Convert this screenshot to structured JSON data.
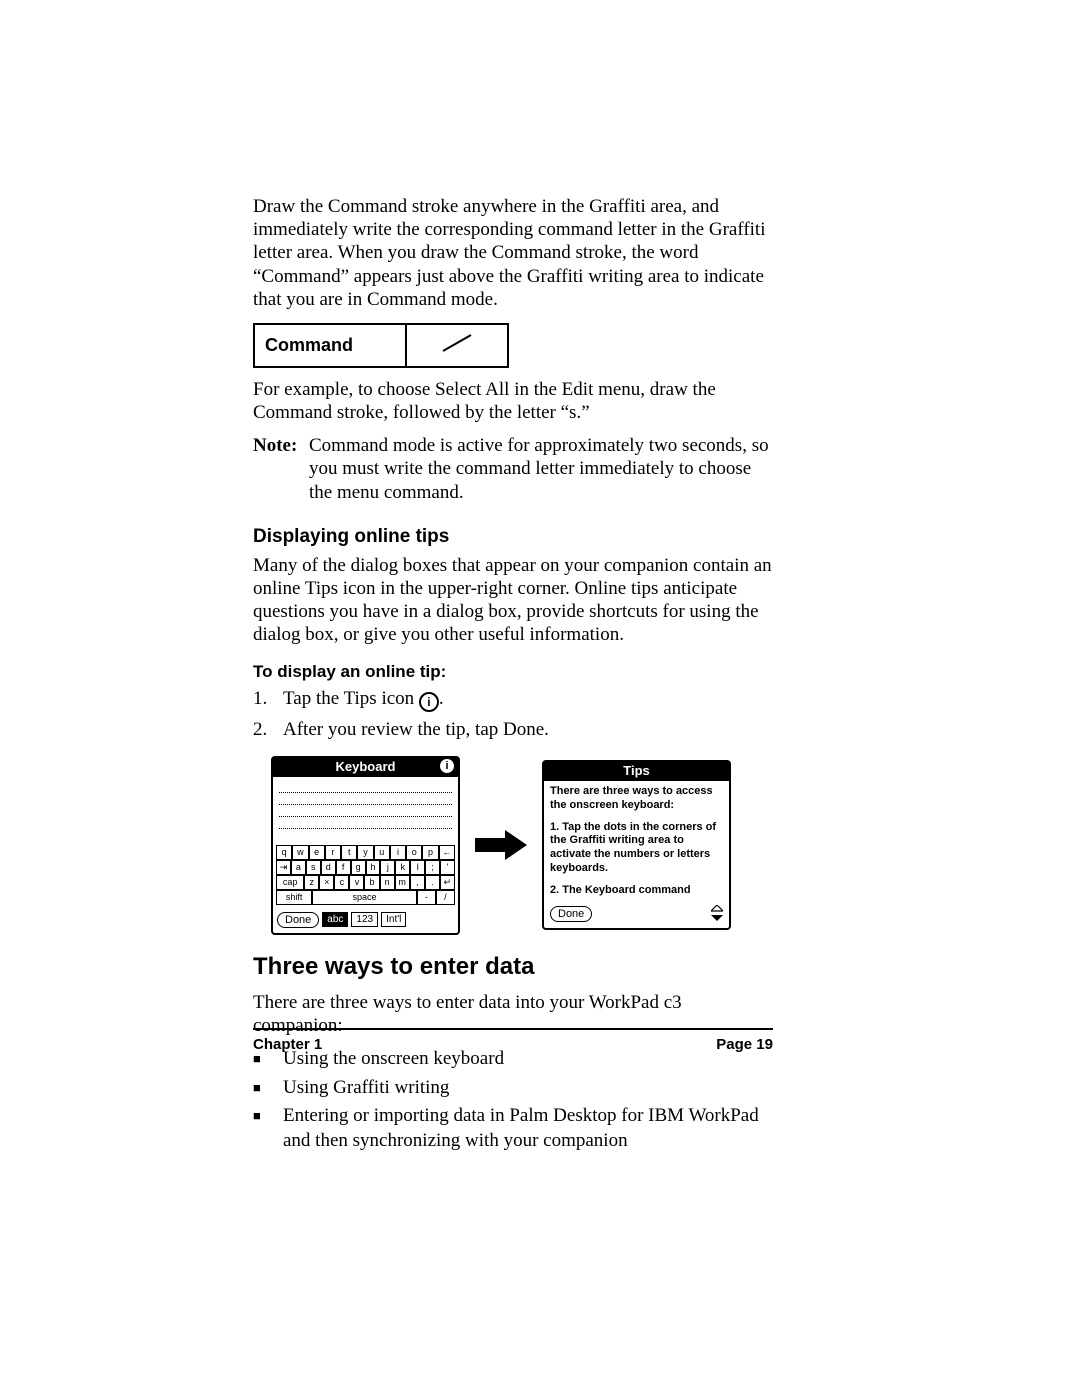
{
  "intro_paragraph": "Draw the Command stroke anywhere in the Graffiti area, and immediately write the corresponding command letter in the Graffiti letter area. When you draw the Command stroke, the word “Command” appears just above the Graffiti writing area to indicate that you are in Command mode.",
  "command_figure": {
    "label": "Command"
  },
  "example_paragraph": "For example, to choose Select All in the Edit menu, draw the Command stroke, followed by the letter “s.”",
  "note": {
    "label": "Note:",
    "text": "Command mode is active for approximately two seconds, so you must write the command letter immediately to choose the menu command."
  },
  "section_tips": {
    "heading": "Displaying online tips",
    "paragraph": "Many of the dialog boxes that appear on your companion contain an online Tips icon in the upper-right corner. Online tips anticipate questions you have in a dialog box, provide shortcuts for using the dialog box, or give you other useful information.",
    "subheading": "To display an online tip:",
    "steps": [
      {
        "num": "1.",
        "text_before": "Tap the Tips icon ",
        "icon": "i",
        "text_after": "."
      },
      {
        "num": "2.",
        "text": "After you review the tip, tap Done."
      }
    ]
  },
  "keyboard_screen": {
    "title": "Keyboard",
    "info_icon": "i",
    "rows": {
      "r1": [
        "q",
        "w",
        "e",
        "r",
        "t",
        "y",
        "u",
        "i",
        "o",
        "p",
        "←"
      ],
      "r2": [
        "⇥",
        "a",
        "s",
        "d",
        "f",
        "g",
        "h",
        "j",
        "k",
        "l",
        ";",
        "'"
      ],
      "r3_cap": "cap",
      "r3": [
        "z",
        "×",
        "c",
        "v",
        "b",
        "n",
        "m",
        ",",
        ".",
        "↵"
      ],
      "r4_shift": "shift",
      "r4_space": "space",
      "r4_dash": "-",
      "r4_slash": "/"
    },
    "done": "Done",
    "tabs": {
      "abc": "abc",
      "num": "123",
      "intl": "Int'l"
    }
  },
  "tips_screen": {
    "title": "Tips",
    "p1": "There are three ways to access the onscreen keyboard:",
    "p2": "1. Tap the dots in the corners of the Graffiti writing area to activate the numbers or letters keyboards.",
    "p3": "2. The Keyboard command",
    "done": "Done"
  },
  "section_enter": {
    "heading": "Three ways to enter data",
    "intro": "There are three ways to enter data into your WorkPad c3 companion:",
    "bullets": [
      "Using the onscreen keyboard",
      "Using Graffiti writing",
      "Entering or importing data in Palm Desktop for IBM WorkPad and then synchronizing with your companion"
    ]
  },
  "footer": {
    "chapter": "Chapter 1",
    "page": "Page 19"
  }
}
